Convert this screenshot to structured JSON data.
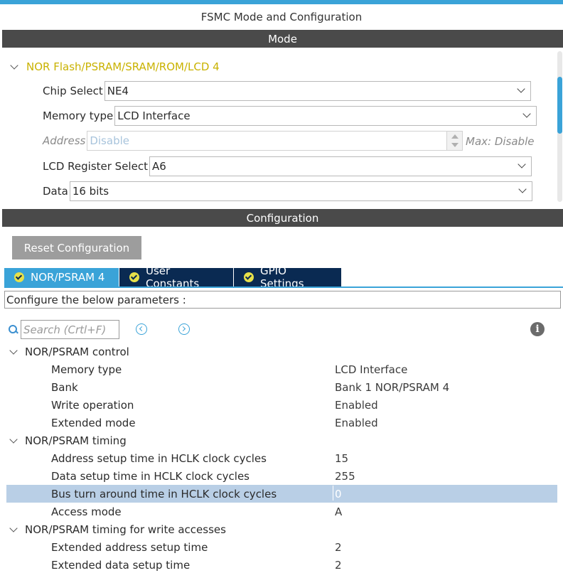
{
  "window": {
    "title": "FSMC Mode and Configuration"
  },
  "mode": {
    "header": "Mode",
    "group_title": "NOR Flash/PSRAM/SRAM/ROM/LCD 4",
    "chip_select": {
      "label": "Chip Select",
      "value": "NE4"
    },
    "memory_type": {
      "label": "Memory type",
      "value": "LCD Interface"
    },
    "address": {
      "label": "Address",
      "value": "Disable",
      "max_label": "Max: Disable"
    },
    "lcd_register_select": {
      "label": "LCD Register Select",
      "value": "A6"
    },
    "data": {
      "label": "Data",
      "value": "16 bits"
    }
  },
  "configuration": {
    "header": "Configuration",
    "reset_button": "Reset Configuration",
    "tabs": [
      {
        "label": "NOR/PSRAM 4",
        "active": true
      },
      {
        "label": "User Constants",
        "active": false
      },
      {
        "label": "GPIO Settings",
        "active": false
      }
    ],
    "hint": "Configure the below parameters :",
    "search": {
      "placeholder": "Search (Crtl+F)"
    },
    "groups": [
      {
        "title": "NOR/PSRAM control",
        "params": [
          {
            "name": "Memory type",
            "value": "LCD Interface"
          },
          {
            "name": "Bank",
            "value": "Bank 1 NOR/PSRAM 4"
          },
          {
            "name": "Write operation",
            "value": "Enabled"
          },
          {
            "name": "Extended mode",
            "value": "Enabled"
          }
        ]
      },
      {
        "title": "NOR/PSRAM timing",
        "params": [
          {
            "name": "Address setup time in HCLK clock cycles",
            "value": "15"
          },
          {
            "name": "Data setup time in HCLK clock cycles",
            "value": "255"
          },
          {
            "name": "Bus turn around time in HCLK clock cycles",
            "value": "0",
            "selected": true
          },
          {
            "name": "Access mode",
            "value": "A"
          }
        ]
      },
      {
        "title": "NOR/PSRAM timing for write accesses",
        "params": [
          {
            "name": "Extended address setup time",
            "value": "2"
          },
          {
            "name": "Extended data setup time",
            "value": "2"
          }
        ]
      }
    ]
  },
  "colors": {
    "accent": "#3aa3d8",
    "section_header_bg": "#4a4a4a",
    "tab_bg": "#0a2a52",
    "group_title": "#c9b200",
    "selected_row": "#b9cfe6",
    "button_bg": "#9d9d9d"
  },
  "icons": [
    "chevron-down-icon",
    "check-circle-icon",
    "search-icon",
    "prev-arrow-icon",
    "next-arrow-icon",
    "info-icon"
  ]
}
